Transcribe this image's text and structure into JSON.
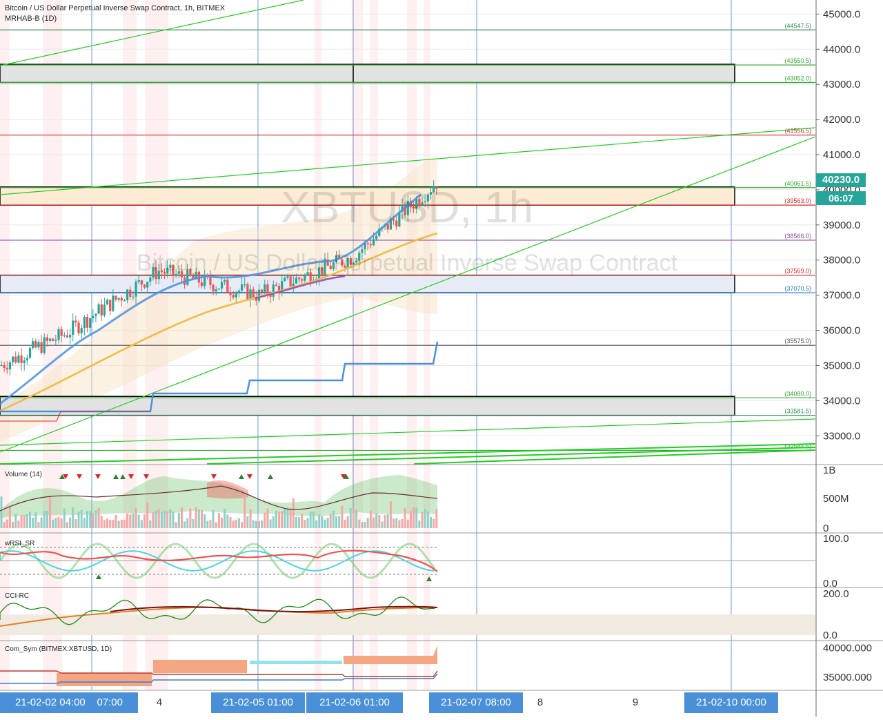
{
  "header": {
    "symbol_title": "Bitcoin / US Dollar Perpetual Inverse Swap Contract, 1h, BITMEX",
    "indicator_line": "MRHAB-B (1D)"
  },
  "watermark": {
    "big": "XBTUSD, 1h",
    "small": "Bitcoin / US Dollar Perpetual Inverse Swap Contract"
  },
  "colors": {
    "grid": "#e8e8e8",
    "axis_text": "#333333",
    "bull": "#26a69a",
    "bear": "#ef5350",
    "price_tag_bg": "#26a69a",
    "blue_vline": "#4a7fd4",
    "trend_green": "#22cc22",
    "ma_blue": "#4a90e2",
    "ma_orange": "#f5b942",
    "ma_purple": "#9b59b6",
    "supertrend_blue": "#4a90e2",
    "chip_blue": "#4a90d9"
  },
  "price_tag": {
    "value": "40230.0",
    "countdown": "06:07"
  },
  "chart_data": [
    {
      "type": "line",
      "pane": "price",
      "title": "Bitcoin / US Dollar Perpetual Inverse Swap Contract, 1h, BITMEX",
      "ylim": [
        32200,
        45400
      ],
      "yticks": [
        "45000.0",
        "44000.0",
        "43000.0",
        "42000.0",
        "41000.0",
        "40000.0",
        "39000.0",
        "38000.0",
        "37000.0",
        "36000.0",
        "35000.0",
        "34000.0",
        "33000.0"
      ],
      "close_series_x": [
        "21-02-02 04:00",
        "21-02-02 07:00",
        "4",
        "21-02-05 01:00",
        "21-02-06 01:00",
        "21-02-07 08:00"
      ],
      "close_values": [
        35200,
        35900,
        37700,
        37000,
        38100,
        40230
      ],
      "horizontal_levels": [
        {
          "label": "44547.5",
          "value": 44547.5,
          "color": "#2e8b57"
        },
        {
          "label": "43550.5",
          "value": 43550.5,
          "color": "#33aa33"
        },
        {
          "label": "43052.0",
          "value": 43052.0,
          "color": "#33aa33"
        },
        {
          "label": "41556.5",
          "value": 41556.5,
          "color": "#d62728"
        },
        {
          "label": "40061.5",
          "value": 40061.5,
          "color": "#33aa33"
        },
        {
          "label": "39563.0",
          "value": 39563.0,
          "color": "#d62728"
        },
        {
          "label": "38566.0",
          "value": 38566.0,
          "color": "#8e44ad"
        },
        {
          "label": "37569.0",
          "value": 37569.0,
          "color": "#d62728"
        },
        {
          "label": "37070.5",
          "value": 37070.5,
          "color": "#1f77d4"
        },
        {
          "label": "35575.0",
          "value": 35575.0,
          "color": "#555555"
        },
        {
          "label": "34080.0",
          "value": 34080.0,
          "color": "#33aa33"
        },
        {
          "label": "33581.5",
          "value": 33581.5,
          "color": "#2e8b57"
        },
        {
          "label": "32584.5",
          "value": 32584.5,
          "color": "#33aa33"
        }
      ],
      "zones": [
        {
          "from": 43052.0,
          "to": 43570.0,
          "fill": "#e2e2e2"
        },
        {
          "from": 39563.0,
          "to": 40080.0,
          "fill": "#fdebd6"
        },
        {
          "from": 37070.5,
          "to": 37570.0,
          "fill": "#e6ebf5"
        },
        {
          "from": 33581.5,
          "to": 34120.0,
          "fill": "#e2e2e2"
        }
      ]
    },
    {
      "type": "bar",
      "pane": "volume",
      "title": "Volume (14)",
      "yticks": [
        "1B",
        "500M",
        "0"
      ],
      "ylim": [
        0,
        1000000000
      ]
    },
    {
      "type": "line",
      "pane": "oscillator",
      "title": "wRSI_SR",
      "yticks": [
        "100.0",
        "0.0"
      ],
      "ylim": [
        0,
        100
      ]
    },
    {
      "type": "line",
      "pane": "oscillator",
      "title": "CCI-RC",
      "yticks": [
        "200.0",
        "0.0"
      ],
      "ylim": [
        0,
        200
      ]
    },
    {
      "type": "area",
      "pane": "comparison",
      "title": "Com_Sym (BITMEX:XBTUSD, 1D)",
      "yticks": [
        "40000.000",
        "35000.000"
      ],
      "ylim": [
        33000,
        41000
      ]
    }
  ],
  "x_axis": {
    "chips": [
      "21-02-02  04:00",
      "07:00",
      "21-02-05  01:00",
      "21-02-06  01:00",
      "21-02-07  08:00",
      "21-02-10  00:00"
    ],
    "plain": [
      "4",
      "8",
      "9"
    ]
  }
}
